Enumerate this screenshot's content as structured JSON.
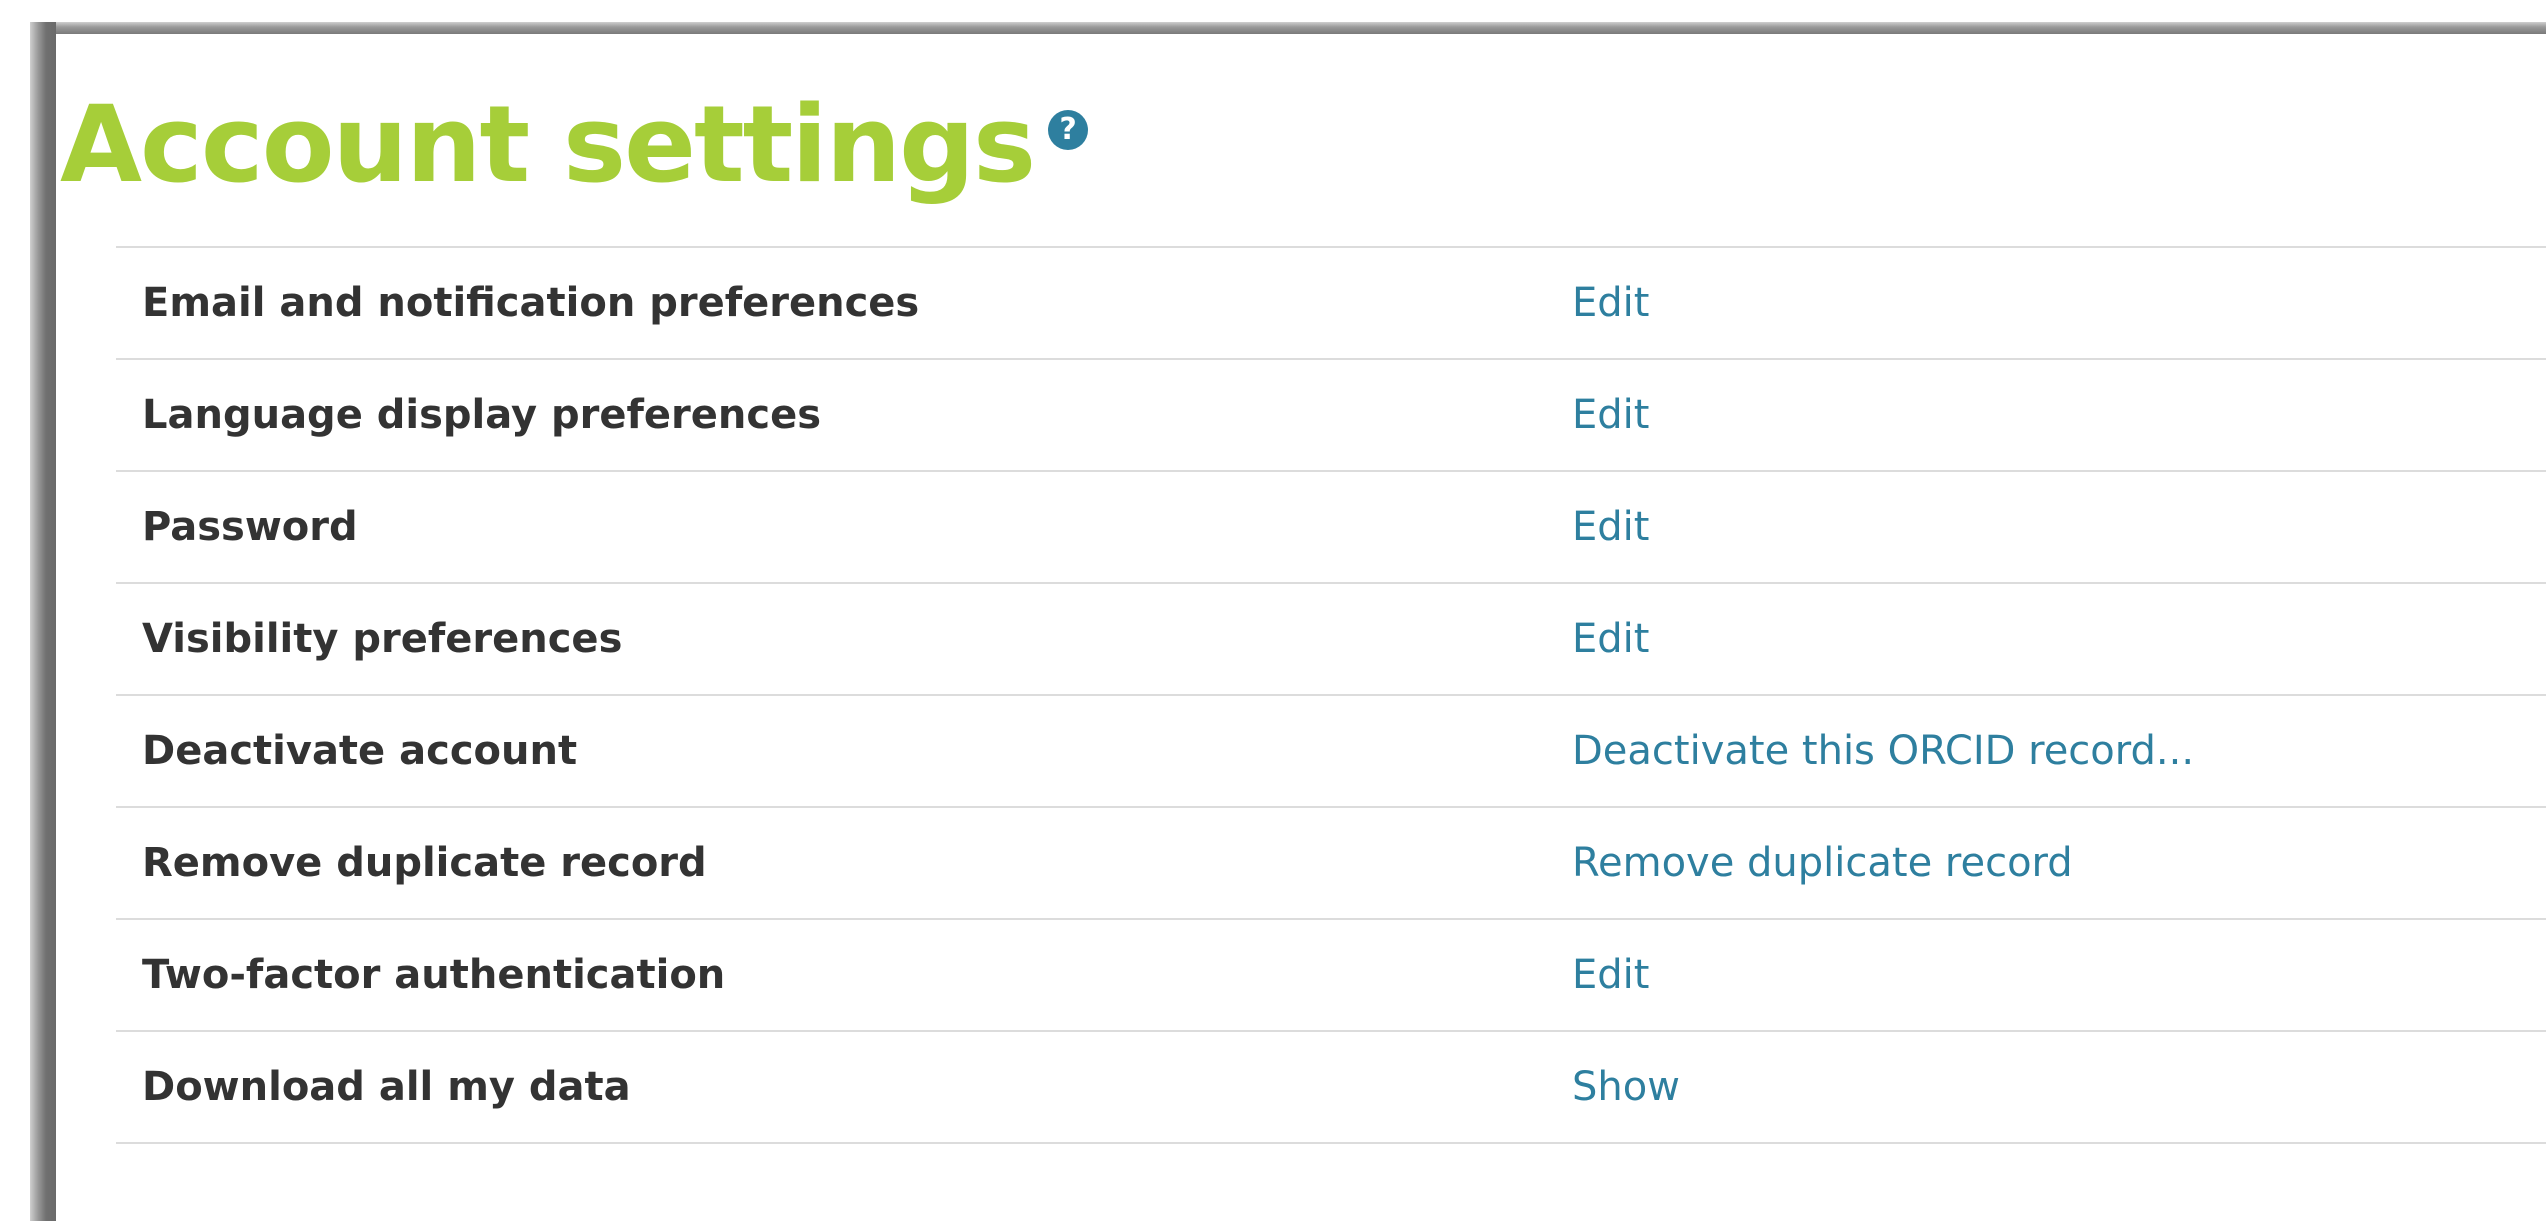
{
  "page": {
    "title": "Account settings",
    "help_icon_glyph": "?",
    "help_icon": "question-circle-icon"
  },
  "colors": {
    "title": "#a6ce39",
    "link": "#2e7f9f",
    "label": "#333333",
    "divider": "#dcdcdc"
  },
  "settings": [
    {
      "label": "Email and notification preferences",
      "action": "Edit"
    },
    {
      "label": "Language display preferences",
      "action": "Edit"
    },
    {
      "label": "Password",
      "action": "Edit"
    },
    {
      "label": "Visibility preferences",
      "action": "Edit"
    },
    {
      "label": "Deactivate account",
      "action": "Deactivate this ORCID record..."
    },
    {
      "label": "Remove duplicate record",
      "action": "Remove duplicate record"
    },
    {
      "label": "Two-factor authentication",
      "action": "Edit"
    },
    {
      "label": "Download all my data",
      "action": "Show"
    }
  ]
}
